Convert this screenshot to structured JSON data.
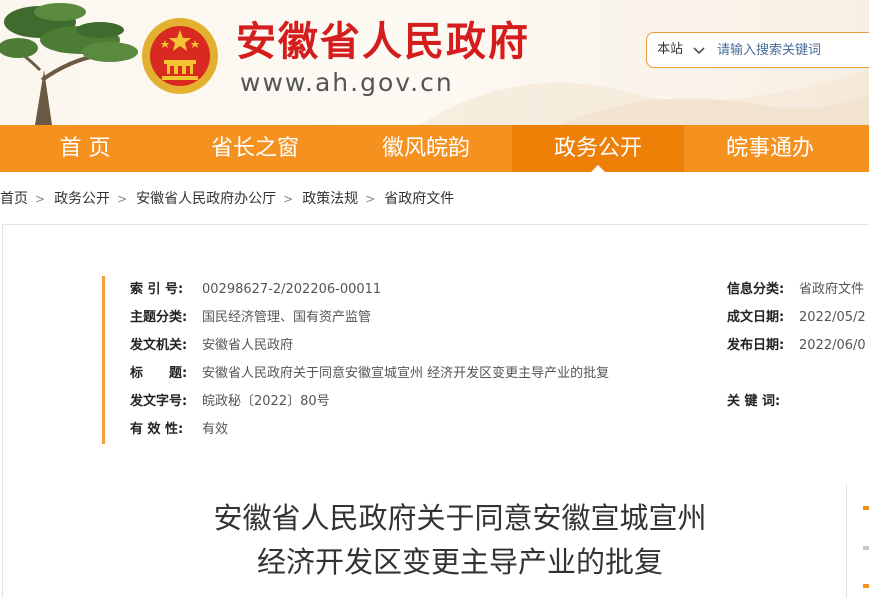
{
  "header": {
    "site_name": "安徽省人民政府",
    "site_url": "www.ah.gov.cn",
    "search": {
      "scope": "本站",
      "placeholder": "请输入搜索关键词"
    }
  },
  "nav": {
    "items": [
      {
        "label": "首 页"
      },
      {
        "label": "省长之窗"
      },
      {
        "label": "徽风皖韵"
      },
      {
        "label": "政务公开"
      },
      {
        "label": "皖事通办"
      }
    ],
    "active_index": 3
  },
  "breadcrumb": [
    "首页",
    "政务公开",
    "安徽省人民政府办公厅",
    "政策法规",
    "省政府文件"
  ],
  "meta": {
    "index_no": {
      "label": "索 引 号:",
      "value": "00298627-2/202206-00011"
    },
    "category": {
      "label": "主题分类:",
      "value": "国民经济管理、国有资产监管"
    },
    "issuer": {
      "label": "发文机关:",
      "value": "安徽省人民政府"
    },
    "title": {
      "label": "标　　题:",
      "value": "安徽省人民政府关于同意安徽宣城宣州 经济开发区变更主导产业的批复"
    },
    "doc_no": {
      "label": "发文字号:",
      "value": "皖政秘〔2022〕80号"
    },
    "validity": {
      "label": "有 效 性:",
      "value": "有效"
    },
    "info_class": {
      "label": "信息分类:",
      "value": "省政府文件"
    },
    "written_date": {
      "label": "成文日期:",
      "value": "2022/05/2"
    },
    "publish_date": {
      "label": "发布日期:",
      "value": "2022/06/0"
    },
    "keywords": {
      "label": "关 键 词:",
      "value": ""
    }
  },
  "document": {
    "title_line1": "安徽省人民政府关于同意安徽宣城宣州",
    "title_line2": "经济开发区变更主导产业的批复"
  },
  "colors": {
    "brand_red": "#d41d1d",
    "nav_orange": "#f5911e",
    "nav_active": "#ee7f07",
    "accent_bar": "#f5a040"
  }
}
